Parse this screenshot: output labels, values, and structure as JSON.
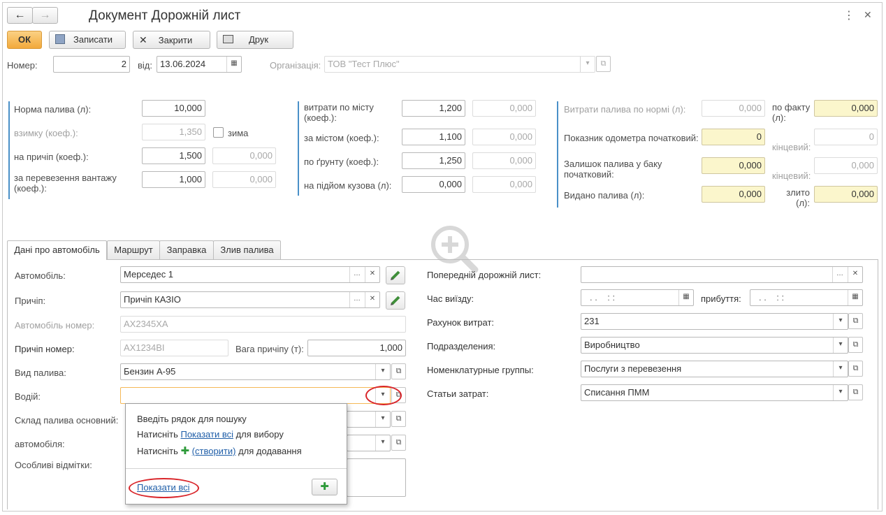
{
  "window": {
    "title": "Документ Дорожній лист",
    "back": "←",
    "forward": "→"
  },
  "toolbar": {
    "ok": "ОК",
    "save": "Записати",
    "close": "Закрити",
    "print": "Друк"
  },
  "header": {
    "number_label": "Номер:",
    "number_value": "2",
    "date_label": "від:",
    "date_value": "13.06.2024",
    "org_label": "Організація:",
    "org_value": "ТОВ \"Тест Плюс\""
  },
  "norms": {
    "fuel_norm_label": "Норма палива (л):",
    "fuel_norm_value": "10,000",
    "winter_label": "взимку (коеф.):",
    "winter_value": "1,350",
    "winter_check_label": "зима",
    "trailer_label": "на причіп (коеф.):",
    "trailer_value": "1,500",
    "trailer_value2": "0,000",
    "cargo_label": "за перевезення вантажу (коеф.):",
    "cargo_value": "1,000",
    "cargo_value2": "0,000"
  },
  "city": {
    "city_label": "витрати по місту (коеф.):",
    "city_value": "1,200",
    "city_value2": "0,000",
    "outcity_label": "за містом (коеф.):",
    "outcity_value": "1,100",
    "outcity_value2": "0,000",
    "ground_label": "по ґрунту (коеф.):",
    "ground_value": "1,250",
    "ground_value2": "0,000",
    "body_label": "на підйом кузова (л):",
    "body_value": "0,000",
    "body_value2": "0,000"
  },
  "fuel": {
    "norm_cost_label": "Витрати палива по нормі (л):",
    "norm_cost_value": "0,000",
    "fact_label": "по факту (л):",
    "fact_value": "0,000",
    "odo_start_label": "Показник одометра початковий:",
    "odo_start_value": "0",
    "odo_end_label": "кінцевий:",
    "odo_end_value": "0",
    "tank_start_label": "Залишок палива у баку початковий:",
    "tank_start_value": "0,000",
    "tank_end_label": "кінцевий:",
    "tank_end_value": "0,000",
    "issued_label": "Видано палива (л):",
    "issued_value": "0,000",
    "drained_label": "злито (л):",
    "drained_value": "0,000"
  },
  "tabs": [
    "Дані про автомобіль",
    "Маршрут",
    "Заправка",
    "Злив палива"
  ],
  "vehicle": {
    "car_label": "Автомобіль:",
    "car_value": "Мерседес 1",
    "trailer_label": "Причіп:",
    "trailer_value": "Причіп КАЗІО",
    "car_no_label": "Автомобіль номер:",
    "car_no_value": "AX2345XA",
    "trailer_no_label": "Причіп номер:",
    "trailer_no_value": "AX1234BI",
    "trailer_weight_label": "Вага причіпу (т):",
    "trailer_weight_value": "1,000",
    "fuel_type_label": "Вид палива:",
    "fuel_type_value": "Бензин А-95",
    "driver_label": "Водій:",
    "driver_value": "",
    "warehouse_label": "Склад палива основний:",
    "car2_label": "автомобіля:",
    "notes_label": "Особливі відмітки:"
  },
  "right": {
    "prev_label": "Попередній дорожній лист:",
    "prev_value": "",
    "depart_label": "Час виїзду:",
    "depart_value": ". .    : :",
    "arrive_label": "прибуття:",
    "arrive_value": ". .    : :",
    "account_label": "Рахунок витрат:",
    "account_value": "231",
    "dept_label": "Подразделения:",
    "dept_value": "Виробництво",
    "nomgroup_label": "Номенклатурные группы:",
    "nomgroup_value": "Послуги з перевезення",
    "cost_label": "Статьи затрат:",
    "cost_value": "Списання ПММ"
  },
  "popup": {
    "line1": "Введіть рядок для пошуку",
    "line2_pre": "Натисніть ",
    "line2_link": "Показати всі",
    "line2_post": " для вибору",
    "line3_pre": "Натисніть ",
    "line3_link": "(створити)",
    "line3_post": " для додавання",
    "show_all": "Показати всі"
  },
  "colors": {
    "accent_blue": "#4a90c8",
    "ok_orange": "#f2a93b",
    "highlight_yellow": "#fbf6cc",
    "annotation_red": "#d9252a",
    "plus_green": "#2e9a3a"
  }
}
